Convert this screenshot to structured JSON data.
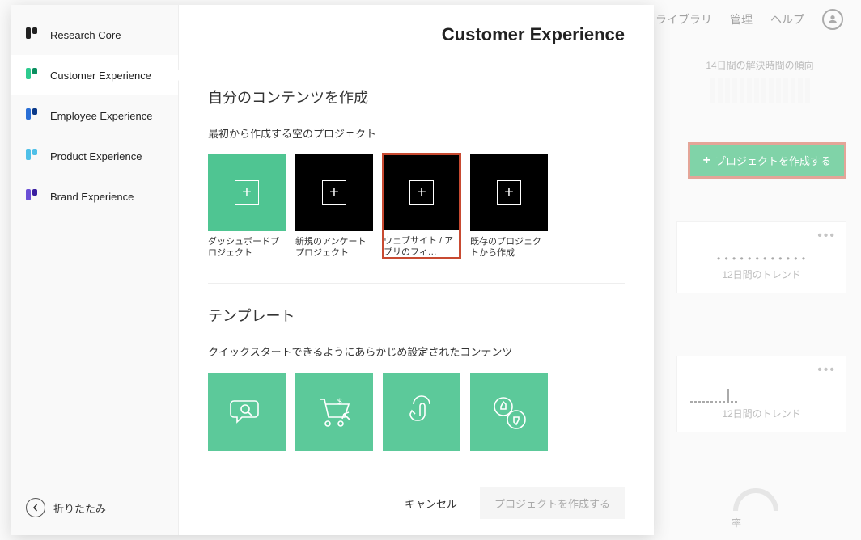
{
  "topnav": {
    "library": "ライブラリ",
    "admin": "管理",
    "help": "ヘルプ"
  },
  "bg": {
    "trend14": "14日間の解決時間の傾向",
    "trend12": "12日間のトレンド",
    "rate_label": "率",
    "create_project": "プロジェクトを作成する"
  },
  "sidebar": {
    "items": [
      {
        "label": "Research Core"
      },
      {
        "label": "Customer Experience"
      },
      {
        "label": "Employee Experience"
      },
      {
        "label": "Product Experience"
      },
      {
        "label": "Brand Experience"
      }
    ],
    "collapse": "折りたたみ"
  },
  "main": {
    "title": "Customer Experience",
    "own_content": "自分のコンテンツを作成",
    "empty_projects_sub": "最初から作成する空のプロジェクト",
    "tiles": [
      {
        "label": "ダッシュボードプロジェクト"
      },
      {
        "label": "新規のアンケートプロジェクト"
      },
      {
        "label": "ウェブサイト / アプリのフィ…"
      },
      {
        "label": "既存のプロジェクトから作成"
      }
    ],
    "templates_heading": "テンプレート",
    "templates_sub": "クイックスタートできるようにあらかじめ設定されたコンテンツ",
    "cancel": "キャンセル",
    "create": "プロジェクトを作成する"
  },
  "colors": {
    "accent": "#4fc592",
    "highlight": "#c84a31",
    "green_btn": "#00a651"
  }
}
